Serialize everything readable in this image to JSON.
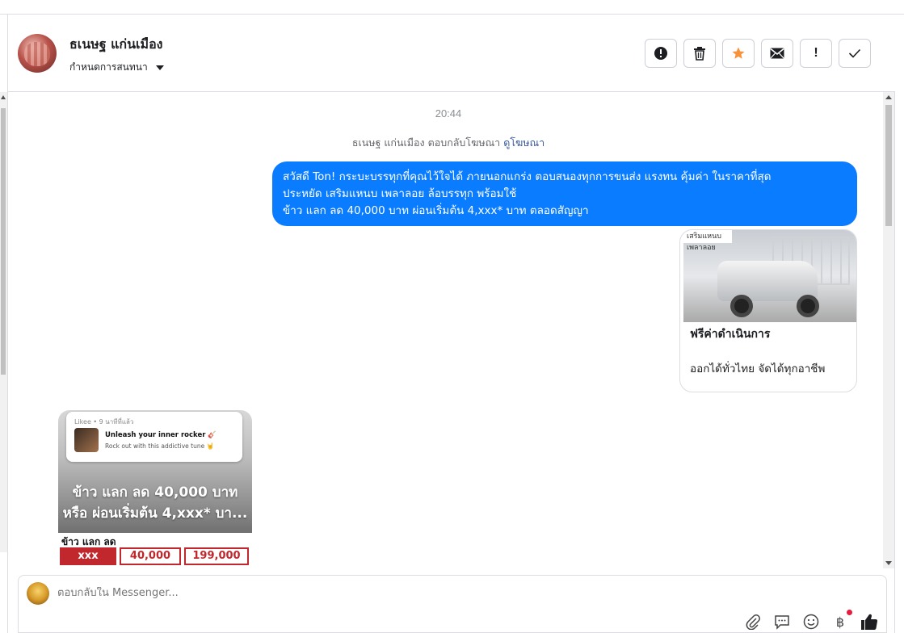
{
  "header": {
    "contact_name": "ธเนษฐ แก่นเมือง",
    "assign_label": "กำหนดการสนทนา"
  },
  "actions": [
    {
      "name": "report-spam-button",
      "icon": "exclamation-circle-icon"
    },
    {
      "name": "delete-button",
      "icon": "trash-icon"
    },
    {
      "name": "star-button",
      "icon": "star-icon",
      "color": "#f7923a"
    },
    {
      "name": "mark-unread-button",
      "icon": "envelope-icon"
    },
    {
      "name": "follow-up-button",
      "icon": "exclamation-icon",
      "label": "!"
    },
    {
      "name": "mark-done-button",
      "icon": "check-icon"
    }
  ],
  "thread": {
    "timestamp": "20:44",
    "reply_note": "ธเนษฐ แก่นเมือง ตอบกลับโฆษณา",
    "reply_link": "ดูโฆษณา",
    "message_lines": [
      "สวัสดี Ton! กระบะบรรทุกที่คุณไว้ใจได้ ภายนอกแกร่ง ตอบสนองทุกการขนส่ง แรงทน คุ้มค่า ในราคาที่สุด",
      "ประหยัด เสริมแหนบ เพลาลอย ล้อบรรทุก พร้อมใช้",
      "ข้าว แลก ลด 40,000 บาท ผ่อนเริ่มต้น 4,xxx* บาท ตลอดสัญญา"
    ],
    "bubble_color": "#0a7cff",
    "card": {
      "image_caption": "เสริมแหนบ เพลาลอย",
      "title": "ฟรีค่าดำเนินการ",
      "description": "ออกได้ทั่วไทย จัดได้ทุกอาชีพ"
    },
    "media": {
      "notif_app": "Likee • 9 นาทีที่แล้ว",
      "notif_title": "Unleash your inner rocker 🎸",
      "notif_text": "Rock out with this addictive tune 🤘",
      "headline_1": "ข้าว แลก ลด 40,000 บาท",
      "headline_2": "หรือ ผ่อนเริ่มต้น 4,xxx* บา...",
      "strip_label": "ข้าว แลก ลด",
      "box_1": "xxx",
      "box_2": "40,000",
      "box_3": "199,000"
    }
  },
  "composer": {
    "placeholder": "ตอบกลับใน Messenger...",
    "currency_symbol": "฿"
  }
}
